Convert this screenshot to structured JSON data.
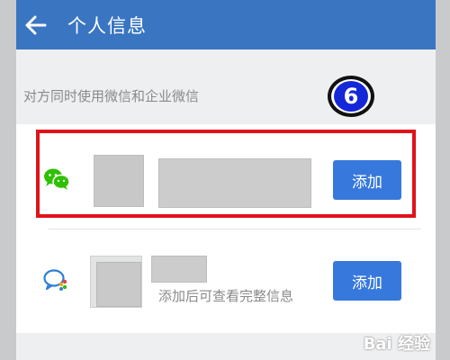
{
  "appbar": {
    "title": "个人信息",
    "back_icon": "arrow-left-icon",
    "background_color": "#3a75c1"
  },
  "hint": "对方同时使用微信和企业微信",
  "step_badge": "6",
  "contacts": [
    {
      "app": "wechat",
      "icon": "wechat-icon",
      "add_label": "添加",
      "highlighted": true
    },
    {
      "app": "wecom",
      "icon": "wecom-icon",
      "subtext": "添加后可查看完整信息",
      "add_label": "添加"
    }
  ],
  "colors": {
    "accent": "#3778dc",
    "highlight_border": "#e0131b",
    "wechat_green": "#2dc100"
  },
  "watermark": "Bai 经验"
}
